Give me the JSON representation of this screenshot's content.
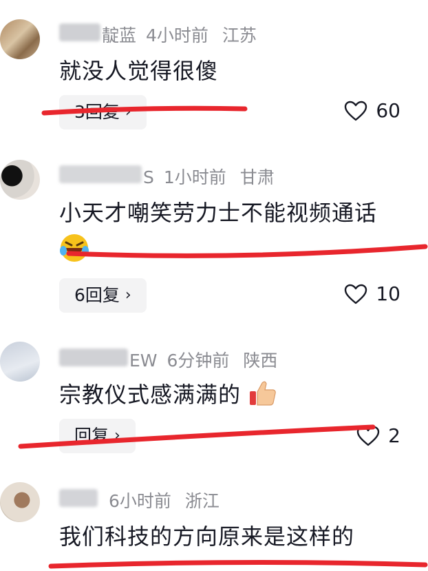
{
  "comments": [
    {
      "name_visible": "靛蓝",
      "time": "4小时前",
      "location": "江苏",
      "text": "就没人觉得很傻",
      "reply_label": "3回复",
      "likes": "60"
    },
    {
      "name_visible": "S",
      "time": "1小时前",
      "location": "甘肃",
      "text": "小天才嘲笑劳力士不能视频通话",
      "reply_label": "6回复",
      "likes": "10"
    },
    {
      "name_visible": "EW",
      "time": "6分钟前",
      "location": "陕西",
      "text": "宗教仪式感满满的",
      "reply_label": "回复",
      "likes": "2"
    },
    {
      "name_visible": "",
      "time": "6小时前",
      "location": "浙江",
      "text": "我们科技的方向原来是这样的",
      "reply_label": "",
      "likes": ""
    }
  ],
  "icons": {
    "like": "heart-outline-icon",
    "chevron": "chevron-right-icon",
    "emoji_laugh": "laughing-crying-emoji",
    "emoji_thumbs": "thumbs-up-emoji"
  },
  "colors": {
    "annotation_red": "#e8262d",
    "meta_gray": "#8a8b91",
    "reply_bg": "#f3f3f4"
  }
}
